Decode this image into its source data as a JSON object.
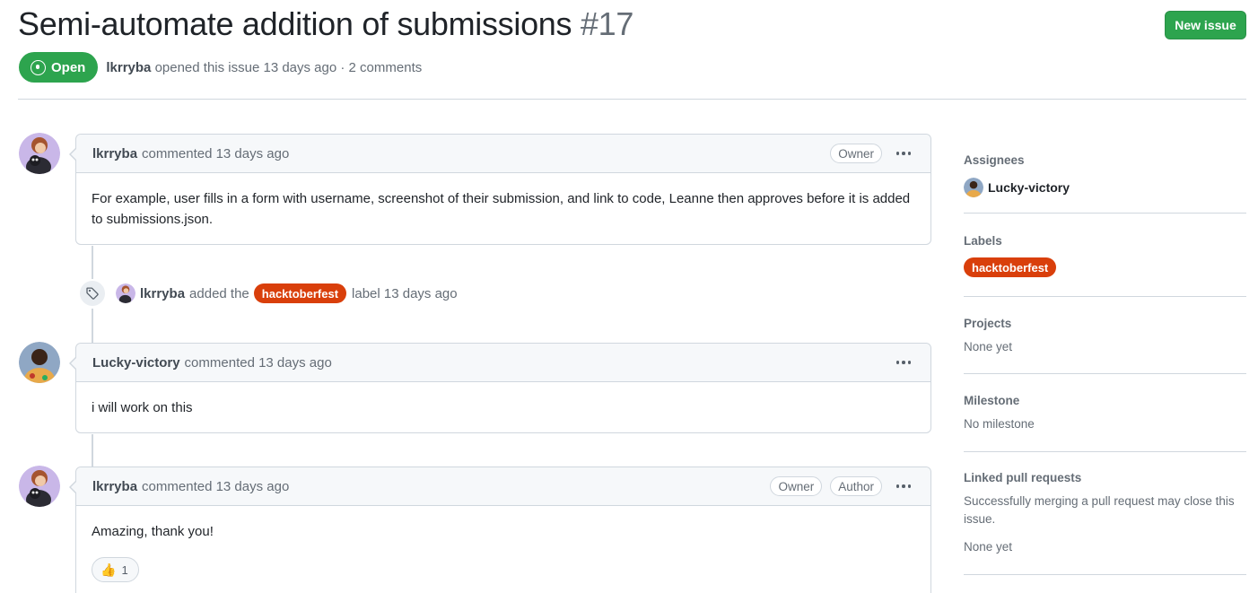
{
  "issue": {
    "title": "Semi-automate addition of submissions",
    "number": "#17",
    "state": "Open",
    "author": "lkrryba",
    "meta_text": "opened this issue 13 days ago · 2 comments"
  },
  "header": {
    "new_issue_label": "New issue"
  },
  "comments": [
    {
      "author": "lkrryba",
      "action": "commented 13 days ago",
      "badges": [
        "Owner"
      ],
      "body": "For example, user fills in a form with username, screenshot of their submission, and link to code, Leanne then approves before it is added to submissions.json."
    },
    {
      "author": "Lucky-victory",
      "action": "commented 13 days ago",
      "badges": [],
      "body": "i will work on this"
    },
    {
      "author": "lkrryba",
      "action": "commented 13 days ago",
      "badges": [
        "Owner",
        "Author"
      ],
      "body": "Amazing, thank you!",
      "reaction": {
        "emoji": "👍",
        "count": "1"
      }
    }
  ],
  "label_event": {
    "actor": "lkrryba",
    "text_before": "added the",
    "label": "hacktoberfest",
    "text_after": "label 13 days ago"
  },
  "sidebar": {
    "assignees": {
      "heading": "Assignees",
      "user": "Lucky-victory"
    },
    "labels": {
      "heading": "Labels",
      "label": "hacktoberfest"
    },
    "projects": {
      "heading": "Projects",
      "value": "None yet"
    },
    "milestone": {
      "heading": "Milestone",
      "value": "No milestone"
    },
    "linked_prs": {
      "heading": "Linked pull requests",
      "description": "Successfully merging a pull request may close this issue.",
      "value": "None yet"
    }
  },
  "colors": {
    "open_green": "#2da44e",
    "label_orange": "#d93f0b",
    "border": "#d0d7de",
    "muted_text": "#656d76"
  }
}
